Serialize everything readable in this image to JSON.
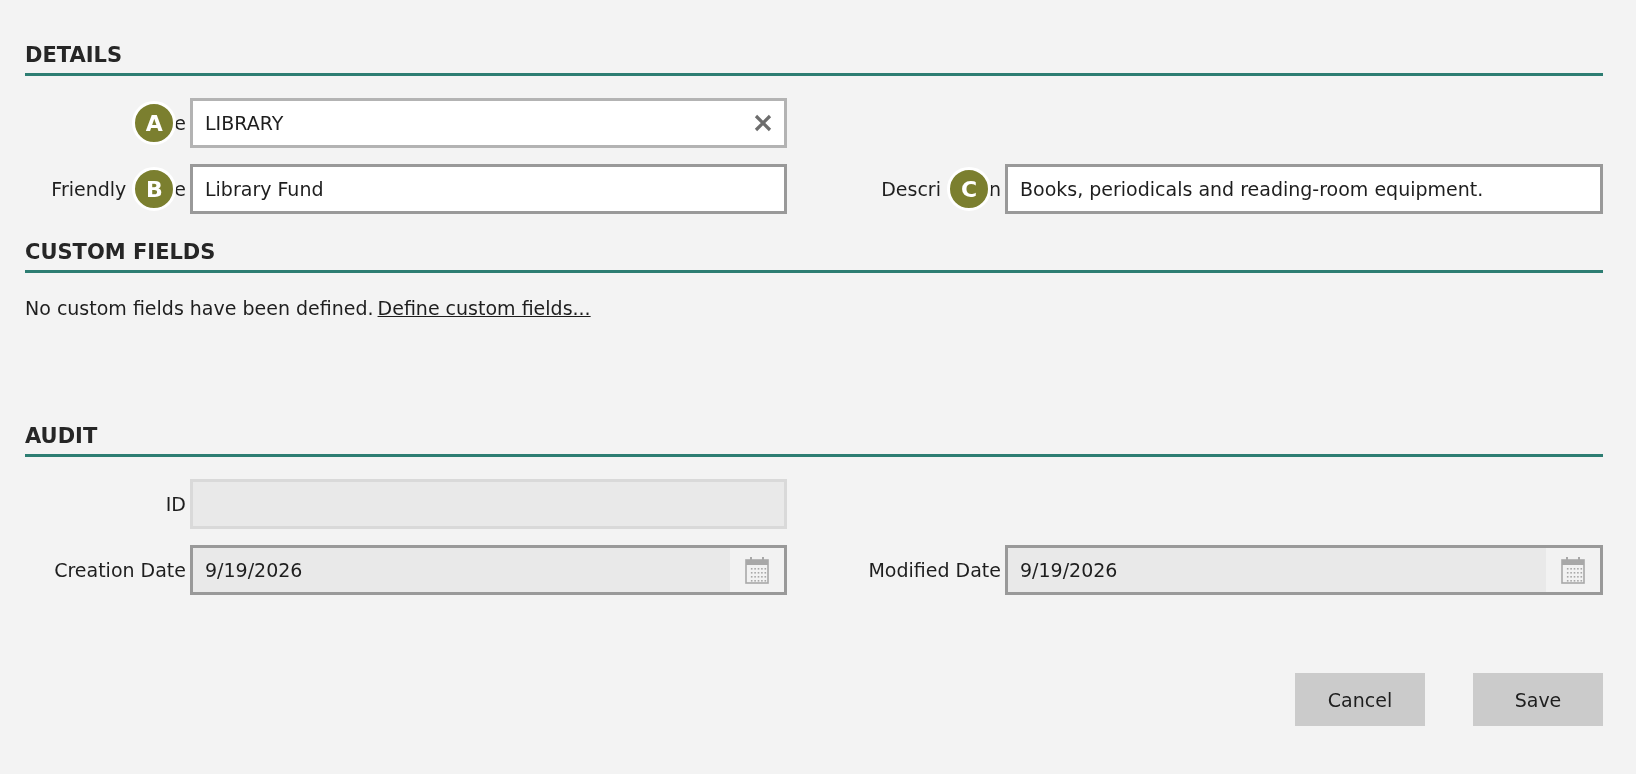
{
  "details": {
    "title": "DETAILS",
    "rows": [
      {
        "left": {
          "kind": "clearable",
          "badge": "A",
          "label_after": "e",
          "value": "LIBRARY",
          "disabled": false
        }
      },
      {
        "left": {
          "kind": "text",
          "badge": "B",
          "label_before": "Friendly",
          "label_after": "e",
          "value": "Library Fund",
          "disabled": false
        },
        "right": {
          "kind": "text",
          "badge": "C",
          "label_before": "Descri",
          "label_after": "n",
          "value": "Books, periodicals and reading-room equipment.",
          "disabled": false
        }
      }
    ]
  },
  "custom_fields": {
    "title": "CUSTOM FIELDS",
    "message": "No custom fields have been defined.",
    "link": "Define custom fields..."
  },
  "audit": {
    "title": "AUDIT",
    "rows": [
      {
        "left": {
          "kind": "text",
          "label": "ID",
          "disabled": true
        }
      },
      {
        "left": {
          "kind": "date",
          "label": "Creation Date",
          "value": "9/19/2026",
          "disabled": false
        },
        "right": {
          "kind": "date",
          "label": "Modified Date",
          "value": "9/19/2026",
          "disabled": false
        }
      }
    ]
  },
  "buttons": [
    "Cancel",
    "Save"
  ]
}
